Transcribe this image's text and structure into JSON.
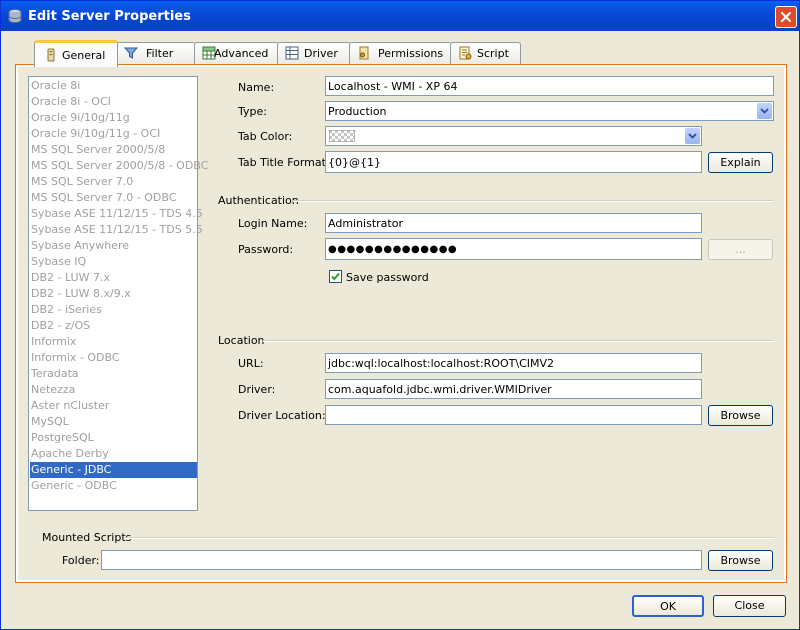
{
  "window": {
    "title": "Edit Server Properties"
  },
  "tabs": [
    {
      "label": "General",
      "icon": "general-icon",
      "active": true
    },
    {
      "label": "Filter",
      "icon": "filter-icon"
    },
    {
      "label": "Advanced",
      "icon": "advanced-icon"
    },
    {
      "label": "Driver",
      "icon": "driver-icon"
    },
    {
      "label": "Permissions",
      "icon": "permissions-icon"
    },
    {
      "label": "Script",
      "icon": "script-icon"
    }
  ],
  "servers": [
    "Oracle 8i",
    "Oracle 8i - OCI",
    "Oracle 9i/10g/11g",
    "Oracle 9i/10g/11g - OCI",
    "MS SQL Server 2000/5/8",
    "MS SQL Server 2000/5/8 - ODBC",
    "MS SQL Server 7.0",
    "MS SQL Server 7.0 - ODBC",
    "Sybase ASE 11/12/15 - TDS 4.5",
    "Sybase ASE 11/12/15 - TDS 5.5",
    "Sybase Anywhere",
    "Sybase IQ",
    "DB2 - LUW 7.x",
    "DB2 - LUW 8.x/9.x",
    "DB2 - iSeries",
    "DB2 - z/OS",
    "Informix",
    "Informix - ODBC",
    "Teradata",
    "Netezza",
    "Aster nCluster",
    "MySQL",
    "PostgreSQL",
    "Apache Derby",
    "Generic - JDBC",
    "Generic - ODBC"
  ],
  "selected_server_index": 24,
  "general": {
    "name_label": "Name:",
    "name_value": "Localhost - WMI - XP 64",
    "type_label": "Type:",
    "type_value": "Production",
    "tabcolor_label": "Tab Color:",
    "tabtitle_label": "Tab Title Format:",
    "tabtitle_value": "{0}@{1}",
    "explain_label": "Explain"
  },
  "authentication": {
    "heading": "Authentication",
    "login_label": "Login Name:",
    "login_value": "Administrator",
    "password_label": "Password:",
    "password_value": "●●●●●●●●●●●●●●",
    "ellipsis_label": "...",
    "save_password_label": "Save password",
    "save_password_checked": true
  },
  "location": {
    "heading": "Location",
    "url_label": "URL:",
    "url_value": "jdbc:wql:localhost:localhost:ROOT\\CIMV2",
    "driver_label": "Driver:",
    "driver_value": "com.aquafold.jdbc.wmi.driver.WMIDriver",
    "driverloc_label": "Driver Location:",
    "driverloc_value": "",
    "browse_label": "Browse"
  },
  "mounted": {
    "heading": "Mounted Scripts",
    "folder_label": "Folder:",
    "folder_value": "",
    "browse_label": "Browse"
  },
  "footer": {
    "ok_label": "OK",
    "close_label": "Close"
  }
}
